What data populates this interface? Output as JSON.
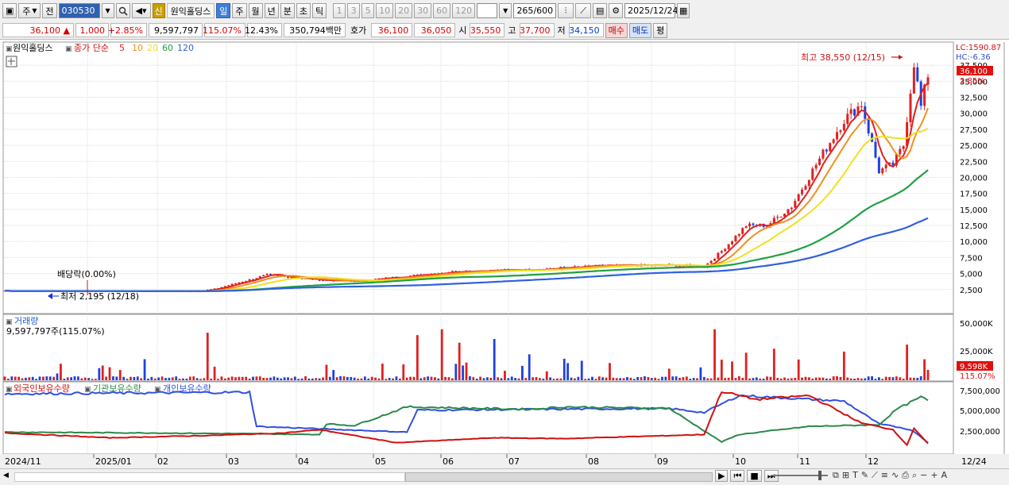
{
  "toolbar": {
    "market": "주",
    "prev_btn": "전",
    "code": "030530",
    "stock_badge": "신",
    "stock_name": "원익홀딩스",
    "periods": [
      "일",
      "주",
      "월",
      "년",
      "분",
      "초",
      "틱"
    ],
    "selected_period": "일",
    "minute_options": [
      "1",
      "3",
      "5",
      "10",
      "20",
      "30",
      "60",
      "120"
    ],
    "count": "265",
    "count_total": "/600",
    "date": "2025/12/24"
  },
  "quote": {
    "price": "36,100",
    "change_arrow": "▲",
    "change": "1,000",
    "change_pct": "+2.85%",
    "volume": "9,597,797",
    "volume_ratio": "115.07%",
    "turnover": "12.43%",
    "amount": "350,794백만",
    "ask_label": "호가",
    "ask": "36,100",
    "bid": "36,050",
    "open_label": "시",
    "open": "35,550",
    "high_label": "고",
    "high": "37,700",
    "low_label": "저",
    "low": "34,150",
    "buy_btn": "매수",
    "sell_btn": "매도",
    "eval_btn": "평"
  },
  "main_panel": {
    "stock_label": "원익홀딩스",
    "ma_title": "종가 단순",
    "ma_periods": [
      "5",
      "10",
      "20",
      "60",
      "120"
    ],
    "lc": "LC:1590.87",
    "hc": "HC:-6.36",
    "price_tag": "36,100",
    "pct_tag": "2.85%",
    "high_annot": "최고 38,550 (12/15)",
    "low_annot": "최저 2,195 (12/18)",
    "dividend": "배당락(0.00%)",
    "y_ticks": [
      "37,500",
      "35,000",
      "32,500",
      "30,000",
      "27,500",
      "25,000",
      "22,500",
      "20,000",
      "17,500",
      "15,000",
      "12,500",
      "10,000",
      "7,500",
      "5,000",
      "2,500"
    ]
  },
  "volume_panel": {
    "title": "거래량",
    "subtitle": "9,597,797주(115.07%)",
    "y_ticks": [
      "50,000K",
      "25,000K"
    ],
    "tag": "9,598K",
    "tag_pct": "115.07%"
  },
  "holding_panel": {
    "legend": [
      "외국인보유수량",
      "기관보유수량",
      "개인보유수량"
    ],
    "y_ticks": [
      "7,500,000",
      "5,000,000",
      "2,500,000"
    ]
  },
  "x_axis": [
    "2024/11",
    "2025/01",
    "02",
    "03",
    "04",
    "05",
    "06",
    "07",
    "08",
    "09",
    "10",
    "11",
    "12",
    "12/24"
  ],
  "colors": {
    "ma5": "#e02020",
    "ma10": "#f09020",
    "ma20": "#f0e020",
    "ma60": "#20a040",
    "ma120": "#3060e0",
    "up": "#e02020",
    "down": "#2040e0",
    "foreign": "#d01010",
    "institution": "#2a8a4a",
    "individual": "#3050e0"
  }
}
